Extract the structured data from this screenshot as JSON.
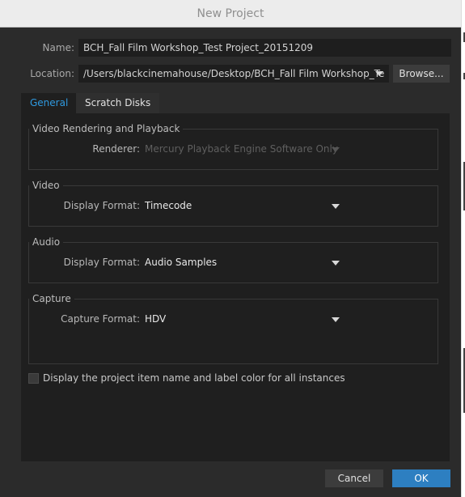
{
  "window": {
    "title": "New Project"
  },
  "name": {
    "label": "Name:",
    "value": "BCH_Fall Film Workshop_Test Project_20151209"
  },
  "location": {
    "label": "Location:",
    "value": "/Users/blackcinemahouse/Desktop/BCH_Fall Film Workshop_Te",
    "browse_label": "Browse..."
  },
  "tabs": [
    {
      "label": "General",
      "active": true
    },
    {
      "label": "Scratch Disks",
      "active": false
    }
  ],
  "groups": {
    "rendering": {
      "title": "Video Rendering and Playback",
      "renderer_label": "Renderer:",
      "renderer_value": "Mercury Playback Engine Software Only",
      "disabled": true
    },
    "video": {
      "title": "Video",
      "label": "Display Format:",
      "value": "Timecode"
    },
    "audio": {
      "title": "Audio",
      "label": "Display Format:",
      "value": "Audio Samples"
    },
    "capture": {
      "title": "Capture",
      "label": "Capture Format:",
      "value": "HDV"
    }
  },
  "checkbox": {
    "label": "Display the project item name and label color for all instances",
    "checked": false
  },
  "footer": {
    "cancel_label": "Cancel",
    "ok_label": "OK"
  },
  "colors": {
    "accent": "#2d7fc1",
    "active_tab_text": "#2f9ae0",
    "background": "#2b2b2b"
  },
  "icons": [
    "dropdown-caret-icon"
  ]
}
